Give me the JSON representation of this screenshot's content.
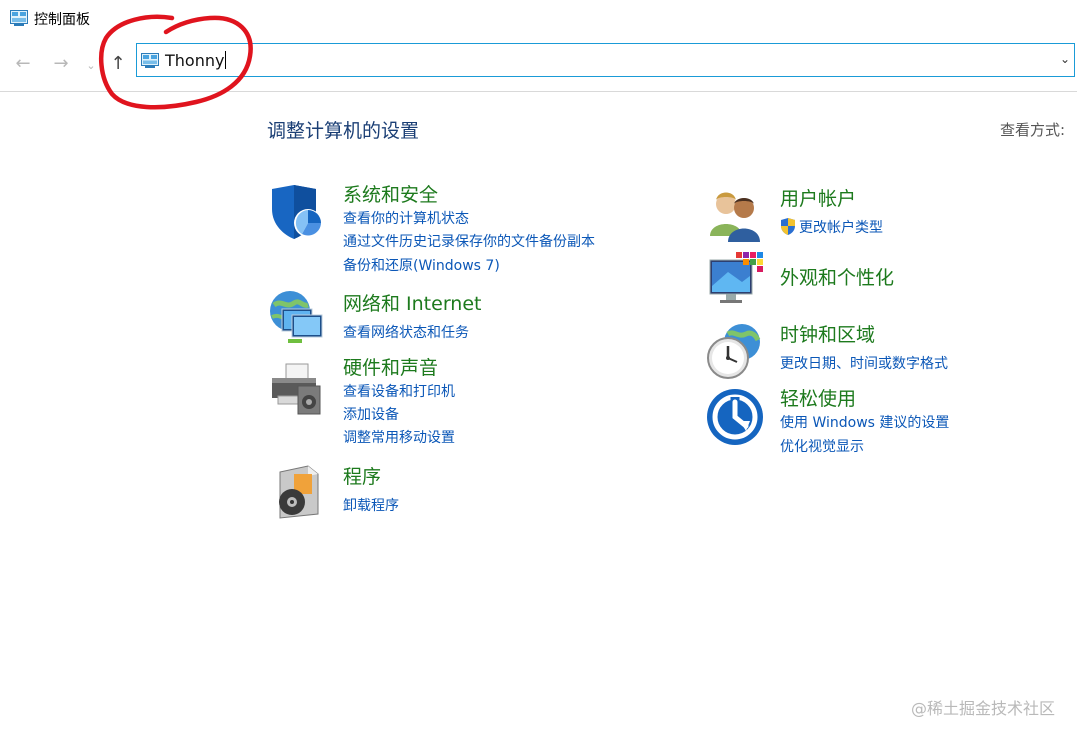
{
  "window": {
    "title": "控制面板"
  },
  "nav": {
    "back_icon": "back-arrow-icon",
    "forward_icon": "forward-arrow-icon",
    "up_icon": "up-arrow-icon",
    "address_value": "Thonny"
  },
  "main": {
    "title": "调整计算机的设置",
    "view_by_label": "查看方式:"
  },
  "categories": [
    {
      "title": "系统和安全",
      "icon": "shield-icon",
      "links": [
        "查看你的计算机状态",
        "通过文件历史记录保存你的文件备份副本",
        "备份和还原(Windows 7)"
      ]
    },
    {
      "title": "网络和 Internet",
      "icon": "network-icon",
      "links": [
        "查看网络状态和任务"
      ]
    },
    {
      "title": "硬件和声音",
      "icon": "printer-icon",
      "links": [
        "查看设备和打印机",
        "添加设备",
        "调整常用移动设置"
      ]
    },
    {
      "title": "程序",
      "icon": "programs-icon",
      "links": [
        "卸载程序"
      ]
    },
    {
      "title": "用户帐户",
      "icon": "users-icon",
      "links": [
        "更改帐户类型"
      ]
    },
    {
      "title": "外观和个性化",
      "icon": "appearance-icon",
      "links": []
    },
    {
      "title": "时钟和区域",
      "icon": "clock-icon",
      "links": [
        "更改日期、时间或数字格式"
      ]
    },
    {
      "title": "轻松使用",
      "icon": "ease-of-access-icon",
      "links": [
        "使用 Windows 建议的设置",
        "优化视觉显示"
      ]
    }
  ],
  "watermark": "@稀土掘金技术社区",
  "colors": {
    "category_title": "#1d7a1d",
    "link": "#0b57b7",
    "page_title": "#1b3f75",
    "address_border": "#1a9bd7",
    "annotation": "#e0141e"
  }
}
